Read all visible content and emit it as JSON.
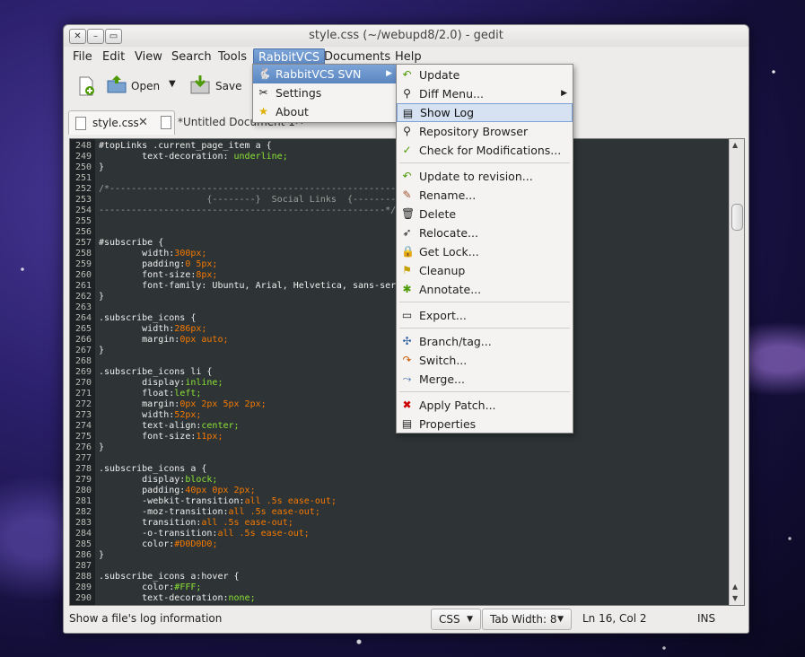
{
  "window": {
    "title": "style.css (~/webupd8/2.0) - gedit"
  },
  "menubar": [
    "File",
    "Edit",
    "View",
    "Search",
    "Tools",
    "RabbitVCS",
    "Documents",
    "Help"
  ],
  "toolbar": {
    "open_label": "Open",
    "save_label": "Save"
  },
  "tabs": [
    {
      "label": "style.css"
    },
    {
      "label": "*Untitled Document 1"
    }
  ],
  "rabbit_menu": {
    "svn": "RabbitVCS SVN",
    "settings": "Settings",
    "about": "About"
  },
  "svn_menu": {
    "update": "Update",
    "diff": "Diff Menu...",
    "showlog": "Show Log",
    "repo": "Repository Browser",
    "check": "Check for Modifications...",
    "updrev": "Update to revision...",
    "rename": "Rename...",
    "delete": "Delete",
    "relocate": "Relocate...",
    "lock": "Get Lock...",
    "cleanup": "Cleanup",
    "annotate": "Annotate...",
    "export": "Export...",
    "branch": "Branch/tag...",
    "switch": "Switch...",
    "merge": "Merge...",
    "patch": "Apply Patch...",
    "props": "Properties"
  },
  "code": [
    {
      "n": "248",
      "t": "#topLinks .current_page_item a {"
    },
    {
      "n": "249",
      "t": "        text-decoration: underline;"
    },
    {
      "n": "250",
      "t": "}"
    },
    {
      "n": "251",
      "t": ""
    },
    {
      "n": "252",
      "t": "/*-----------------------------------------------------"
    },
    {
      "n": "253",
      "t": "                    {--------}  Social Links  {--------}"
    },
    {
      "n": "254",
      "t": "-----------------------------------------------------*/"
    },
    {
      "n": "255",
      "t": ""
    },
    {
      "n": "256",
      "t": ""
    },
    {
      "n": "257",
      "t": "#subscribe {"
    },
    {
      "n": "258",
      "t": "        width:300px;"
    },
    {
      "n": "259",
      "t": "        padding:0 5px;"
    },
    {
      "n": "260",
      "t": "        font-size:8px;"
    },
    {
      "n": "261",
      "t": "        font-family: Ubuntu, Arial, Helvetica, sans-serif"
    },
    {
      "n": "262",
      "t": "}"
    },
    {
      "n": "263",
      "t": ""
    },
    {
      "n": "264",
      "t": ".subscribe_icons {"
    },
    {
      "n": "265",
      "t": "        width:286px;"
    },
    {
      "n": "266",
      "t": "        margin:0px auto;"
    },
    {
      "n": "267",
      "t": "}"
    },
    {
      "n": "268",
      "t": ""
    },
    {
      "n": "269",
      "t": ".subscribe_icons li {"
    },
    {
      "n": "270",
      "t": "        display:inline;"
    },
    {
      "n": "271",
      "t": "        float:left;"
    },
    {
      "n": "272",
      "t": "        margin:0px 2px 5px 2px;"
    },
    {
      "n": "273",
      "t": "        width:52px;"
    },
    {
      "n": "274",
      "t": "        text-align:center;"
    },
    {
      "n": "275",
      "t": "        font-size:11px;"
    },
    {
      "n": "276",
      "t": "}"
    },
    {
      "n": "277",
      "t": ""
    },
    {
      "n": "278",
      "t": ".subscribe_icons a {"
    },
    {
      "n": "279",
      "t": "        display:block;"
    },
    {
      "n": "280",
      "t": "        padding:40px 0px 2px;"
    },
    {
      "n": "281",
      "t": "        -webkit-transition:all .5s ease-out;"
    },
    {
      "n": "282",
      "t": "        -moz-transition:all .5s ease-out;"
    },
    {
      "n": "283",
      "t": "        transition:all .5s ease-out;"
    },
    {
      "n": "284",
      "t": "        -o-transition:all .5s ease-out;"
    },
    {
      "n": "285",
      "t": "        color:#D0D0D0;"
    },
    {
      "n": "286",
      "t": "}"
    },
    {
      "n": "287",
      "t": ""
    },
    {
      "n": "288",
      "t": ".subscribe_icons a:hover {"
    },
    {
      "n": "289",
      "t": "        color:#FFF;"
    },
    {
      "n": "290",
      "t": "        text-decoration:none;"
    }
  ],
  "status": {
    "message": "Show a file's log information",
    "lang": "CSS",
    "tabwidth": "Tab Width:  8",
    "position": "Ln 16, Col 2",
    "mode": "INS"
  },
  "colors": {
    "highlight": "#5a86c0",
    "editor_bg": "#2e3436"
  }
}
